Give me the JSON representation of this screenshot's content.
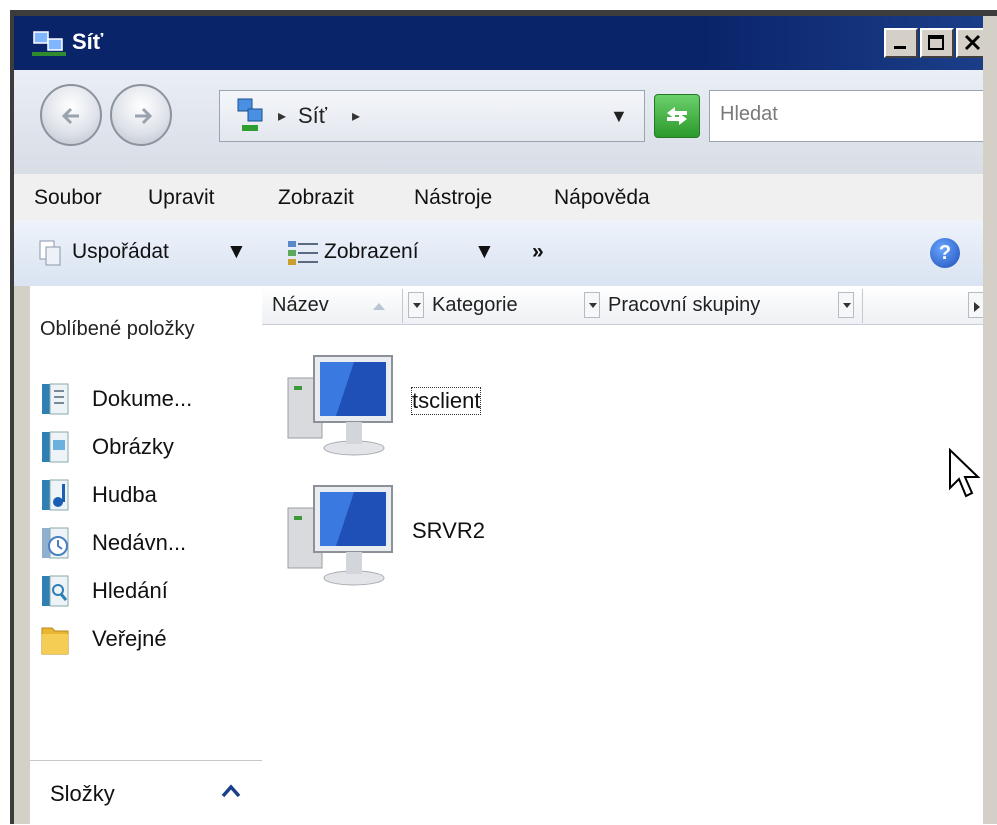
{
  "window": {
    "title": "Síť",
    "controls": [
      "minimize-icon",
      "maximize-icon",
      "close-icon"
    ]
  },
  "address_bar": {
    "path_label": "Síť",
    "search_placeholder": "Hledat"
  },
  "menu": {
    "items": [
      "Soubor",
      "Upravit",
      "Zobrazit",
      "Nástroje",
      "Nápověda"
    ]
  },
  "command_bar": {
    "organize_label": "Uspořádat",
    "views_label": "Zobrazení",
    "more_label": "»"
  },
  "left_pane": {
    "header": "Oblíbené položky",
    "items": [
      {
        "label": "Dokume...",
        "icon": "documents-icon"
      },
      {
        "label": "Obrázky",
        "icon": "pictures-icon"
      },
      {
        "label": "Hudba",
        "icon": "music-icon"
      },
      {
        "label": "Nedávn...",
        "icon": "recent-icon"
      },
      {
        "label": "Hledání",
        "icon": "searches-icon"
      },
      {
        "label": "Veřejné",
        "icon": "public-folder-icon"
      }
    ],
    "folders_label": "Složky"
  },
  "columns": [
    "Název",
    "Kategorie",
    "Pracovní skupiny"
  ],
  "items": [
    {
      "label": "tsclient",
      "icon": "computer-icon",
      "focused": true
    },
    {
      "label": "SRVR2",
      "icon": "computer-icon",
      "focused": false
    }
  ],
  "colors": {
    "title_bar": "#0a246a",
    "window_face": "#d4d0c8",
    "command_bar": "#dde6f3"
  }
}
